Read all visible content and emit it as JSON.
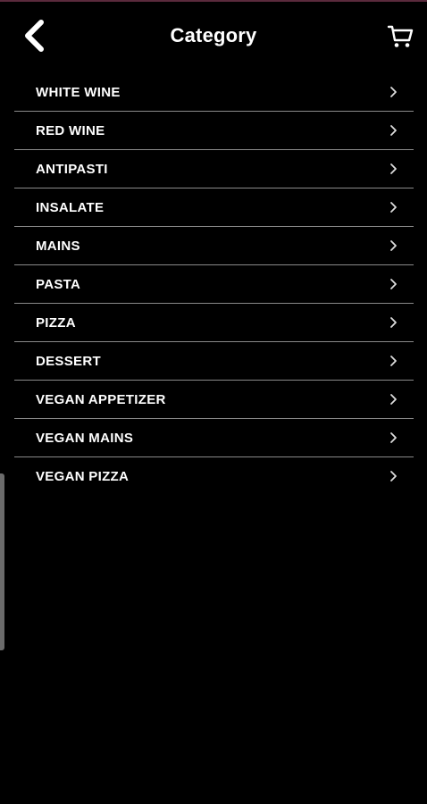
{
  "header": {
    "title": "Category",
    "back_icon": "back-chevron-icon",
    "cart_icon": "shopping-cart-icon"
  },
  "categories": [
    {
      "label": "WHITE WINE"
    },
    {
      "label": "RED WINE"
    },
    {
      "label": "ANTIPASTI"
    },
    {
      "label": "INSALATE"
    },
    {
      "label": "MAINS"
    },
    {
      "label": "PASTA"
    },
    {
      "label": "PIZZA"
    },
    {
      "label": "DESSERT"
    },
    {
      "label": "VEGAN APPETIZER"
    },
    {
      "label": "VEGAN MAINS"
    },
    {
      "label": "VEGAN PIZZA"
    }
  ],
  "colors": {
    "background": "#000000",
    "text": "#ffffff",
    "divider": "#8a8a8a",
    "accent_top": "#5a2a3c"
  }
}
